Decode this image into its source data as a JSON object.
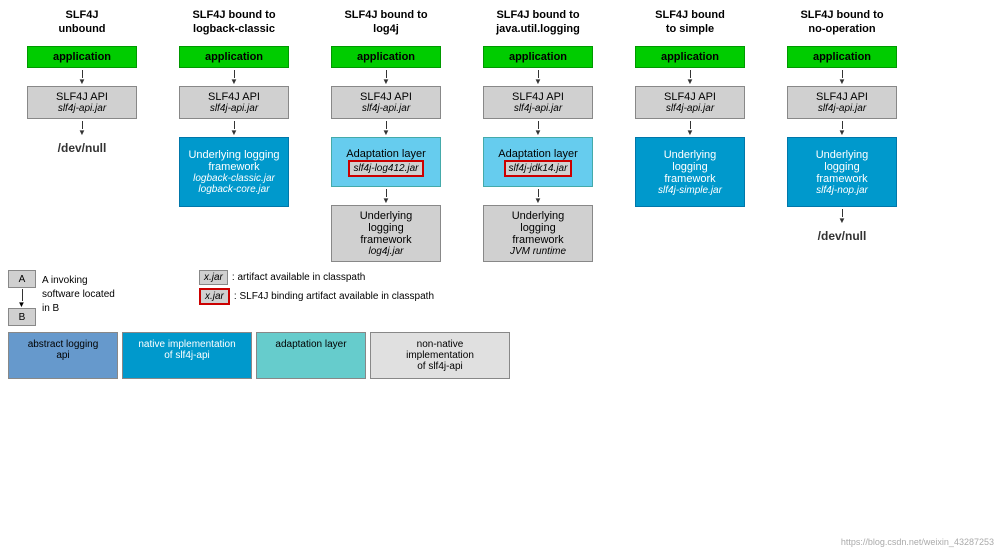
{
  "columns": [
    {
      "id": "unbound",
      "title": "SLF4J\nunbound",
      "rows": [
        {
          "type": "green",
          "text": "application"
        },
        {
          "type": "arrow"
        },
        {
          "type": "gray",
          "text": "SLF4J API",
          "jar": "slf4j-api.jar"
        },
        {
          "type": "arrow"
        },
        {
          "type": "null",
          "text": "/dev/null"
        }
      ]
    },
    {
      "id": "logback",
      "title": "SLF4J bound to\nlogback-classic",
      "rows": [
        {
          "type": "green",
          "text": "application"
        },
        {
          "type": "arrow"
        },
        {
          "type": "gray",
          "text": "SLF4J API",
          "jar": "slf4j-api.jar"
        },
        {
          "type": "arrow"
        },
        {
          "type": "blue-dark",
          "text": "Underlying logging\nframework",
          "jar": "logback-classic.jar\nlogback-core.jar"
        }
      ]
    },
    {
      "id": "log4j",
      "title": "SLF4J bound to\nlog4j",
      "rows": [
        {
          "type": "green",
          "text": "application"
        },
        {
          "type": "arrow"
        },
        {
          "type": "gray",
          "text": "SLF4J API",
          "jar": "slf4j-api.jar"
        },
        {
          "type": "arrow"
        },
        {
          "type": "blue-light",
          "text": "Adaptation layer",
          "jar": "slf4j-log412.jar",
          "jar-red": true
        },
        {
          "type": "arrow"
        },
        {
          "type": "gray",
          "text": "Underlying\nlogging\nframework",
          "jar": "log4j.jar"
        }
      ]
    },
    {
      "id": "jul",
      "title": "SLF4J bound to\njava.util.logging",
      "rows": [
        {
          "type": "green",
          "text": "application"
        },
        {
          "type": "arrow"
        },
        {
          "type": "gray",
          "text": "SLF4J API",
          "jar": "slf4j-api.jar"
        },
        {
          "type": "arrow"
        },
        {
          "type": "blue-light",
          "text": "Adaptation layer",
          "jar": "slf4j-jdk14.jar",
          "jar-red": true
        },
        {
          "type": "arrow"
        },
        {
          "type": "gray",
          "text": "Underlying\nlogging\nframework",
          "jar": "JVM runtime"
        }
      ]
    },
    {
      "id": "simple",
      "title": "SLF4J bound\nto simple",
      "rows": [
        {
          "type": "green",
          "text": "application"
        },
        {
          "type": "arrow"
        },
        {
          "type": "gray",
          "text": "SLF4J API",
          "jar": "slf4j-api.jar"
        },
        {
          "type": "arrow"
        },
        {
          "type": "blue-dark",
          "text": "Underlying\nlogging\nframework",
          "jar": "slf4j-simple.jar"
        }
      ]
    },
    {
      "id": "nop",
      "title": "SLF4J bound to\nno-operation",
      "rows": [
        {
          "type": "green",
          "text": "application"
        },
        {
          "type": "arrow"
        },
        {
          "type": "gray",
          "text": "SLF4J API",
          "jar": "slf4j-api.jar"
        },
        {
          "type": "arrow"
        },
        {
          "type": "blue-dark",
          "text": "Underlying\nlogging\nframework",
          "jar": "slf4j-nop.jar"
        },
        {
          "type": "arrow"
        },
        {
          "type": "null",
          "text": "/dev/null"
        }
      ]
    }
  ],
  "legend": {
    "ab_label": "A invoking\nsoftware located\nin B",
    "a_text": "A",
    "b_text": "B",
    "items": [
      {
        "jar": "x.jar",
        "desc": ": artifact available in classpath",
        "red": false
      },
      {
        "jar": "x.jar",
        "desc": ": SLF4J binding artifact available in classpath",
        "red": true
      }
    ],
    "colors": [
      {
        "bg": "#6699cc",
        "text": "#000",
        "label": "abstract logging\napi"
      },
      {
        "bg": "#0099cc",
        "text": "#fff",
        "label": "native implementation\nof slf4j-api"
      },
      {
        "bg": "#66cccc",
        "text": "#000",
        "label": "adaptation layer"
      },
      {
        "bg": "#e0e0e0",
        "text": "#000",
        "label": "non-native\nimplementation\nof slf4j-api"
      }
    ]
  },
  "watermark": "https://blog.csdn.net/weixin_43287253"
}
